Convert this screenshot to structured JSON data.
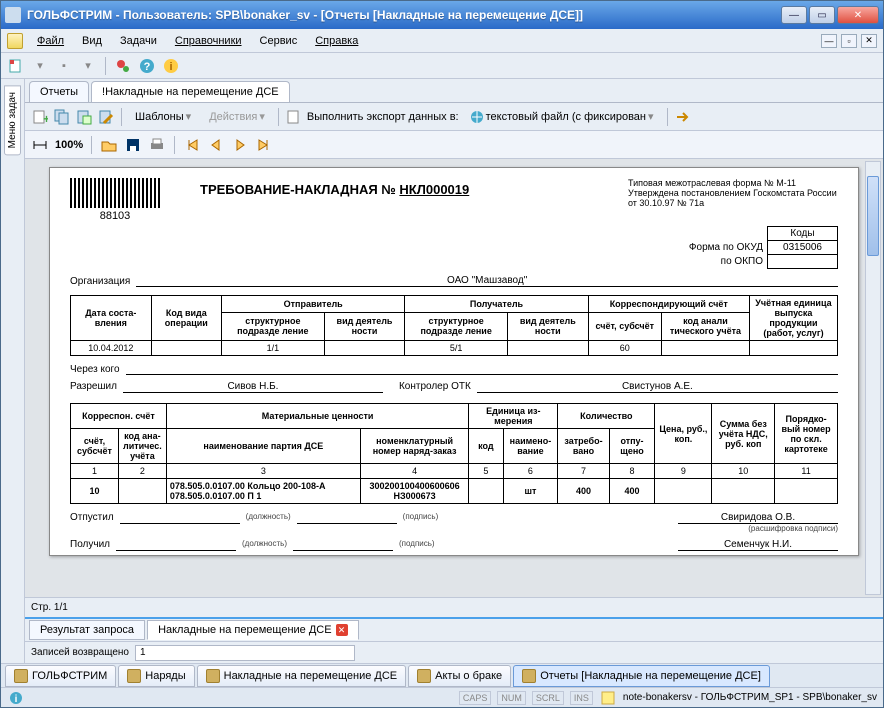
{
  "title": "ГОЛЬФСТРИМ - Пользователь: SPB\\bonaker_sv - [Отчеты  [Накладные на перемещение ДСЕ]]",
  "menus": {
    "file": "Файл",
    "view": "Вид",
    "tasks": "Задачи",
    "refs": "Справочники",
    "service": "Сервис",
    "help": "Справка"
  },
  "sidebar": {
    "label": "Меню задач"
  },
  "tabs1": {
    "reports": "Отчеты",
    "waybills": "!Накладные на перемещение ДСЕ"
  },
  "tb2": {
    "templates": "Шаблоны",
    "actions": "Действия",
    "export_label": "Выполнить экспорт данных в:",
    "export_fmt": "текстовый файл (с фиксирован"
  },
  "tb3": {
    "zoom": "100%"
  },
  "doc": {
    "barcode": "88103",
    "title_prefix": "ТРЕБОВАНИЕ-НАКЛАДНАЯ №",
    "title_num": "НКЛ000019",
    "legal1": "Типовая межотраслевая форма № М-11",
    "legal2": "Утверждена постановлением Госкомстата России",
    "legal3": "от 30.10.97 № 71а",
    "codes_hdr": "Коды",
    "okud_label": "Форма по ОКУД",
    "okud": "0315006",
    "okpo_label": "по ОКПО",
    "okpo": "",
    "org_label": "Организация",
    "org": "ОАО \"Машзавод\"",
    "headers": {
      "date": "Дата соста-вления",
      "optype": "Код вида операции",
      "sender": "Отправитель",
      "recipient": "Получатель",
      "struct": "структурное подразде ление",
      "activity": "вид деятель ности",
      "corr": "Корреспондирующий счёт",
      "account": "счёт, субсчёт",
      "anal": "код анали тического учёта",
      "accunit": "Учётная единица выпуска продукции (работ, услуг)"
    },
    "row1": {
      "date": "10.04.2012",
      "op": "",
      "sender_struct": "1/1",
      "sender_act": "",
      "recv_struct": "5/1",
      "recv_act": "",
      "acct": "60",
      "anal": "",
      "unit": ""
    },
    "via_label": "Через кого",
    "via": "",
    "allowed_label": "Разрешил",
    "allowed": "Сивов Н.Б.",
    "ctrl_label": "Контролер ОТК",
    "ctrl": "Свистунов А.Е.",
    "t2h": {
      "corr": "Корреспон. счёт",
      "acct": "счёт, субсчёт",
      "anal": "код ана-литичес. учёта",
      "matval": "Материальные ценности",
      "name": "наименование партия ДСЕ",
      "nomen": "номенклатурный номер наряд-заказ",
      "unit": "Единица из-мерения",
      "code": "код",
      "uname": "наимено-вание",
      "qty": "Количество",
      "req": "затребо-вано",
      "rel": "отпу-щено",
      "price": "Цена, руб., коп.",
      "sum": "Сумма без учёта НДС, руб. коп",
      "ord": "Порядко-вый номер по скл. картотеке"
    },
    "t2cols": [
      "1",
      "2",
      "3",
      "4",
      "5",
      "6",
      "7",
      "8",
      "9",
      "10",
      "11"
    ],
    "t2r": {
      "acct": "10",
      "anal": "",
      "name": "078.505.0.0107.00 Кольцо 200-108-А 078.505.0.0107.00 П 1",
      "nomen": "300200100400600606 НЗ000673",
      "code": "",
      "uname": "шт",
      "req": "400",
      "rel": "400",
      "price": "",
      "sum": "",
      "ord": ""
    },
    "sig": {
      "released_label": "Отпустил",
      "received_label": "Получил",
      "pos": "(должность)",
      "sign": "(подпись)",
      "decode": "(расшифровка подписи)",
      "n1": "Свиридова О.В.",
      "n2": "Семенчук Н.И."
    }
  },
  "pager": "Стр. 1/1",
  "btabs": {
    "result": "Результат запроса",
    "waybills": "Накладные на перемещение ДСЕ"
  },
  "status": {
    "records_label": "Записей возвращено",
    "records": "1"
  },
  "ftabs": {
    "golf": "ГОЛЬФСТРИМ",
    "orders": "Наряды",
    "waybills": "Накладные на перемещение ДСЕ",
    "defects": "Акты о браке",
    "reports": "Отчеты  [Накладные на перемещение ДСЕ]"
  },
  "indic": {
    "caps": "CAPS",
    "num": "NUM",
    "scrl": "SCRL",
    "ins": "INS"
  },
  "bottom_app": "note-bonakersv - ГОЛЬФСТРИМ_SP1 - SPB\\bonaker_sv"
}
